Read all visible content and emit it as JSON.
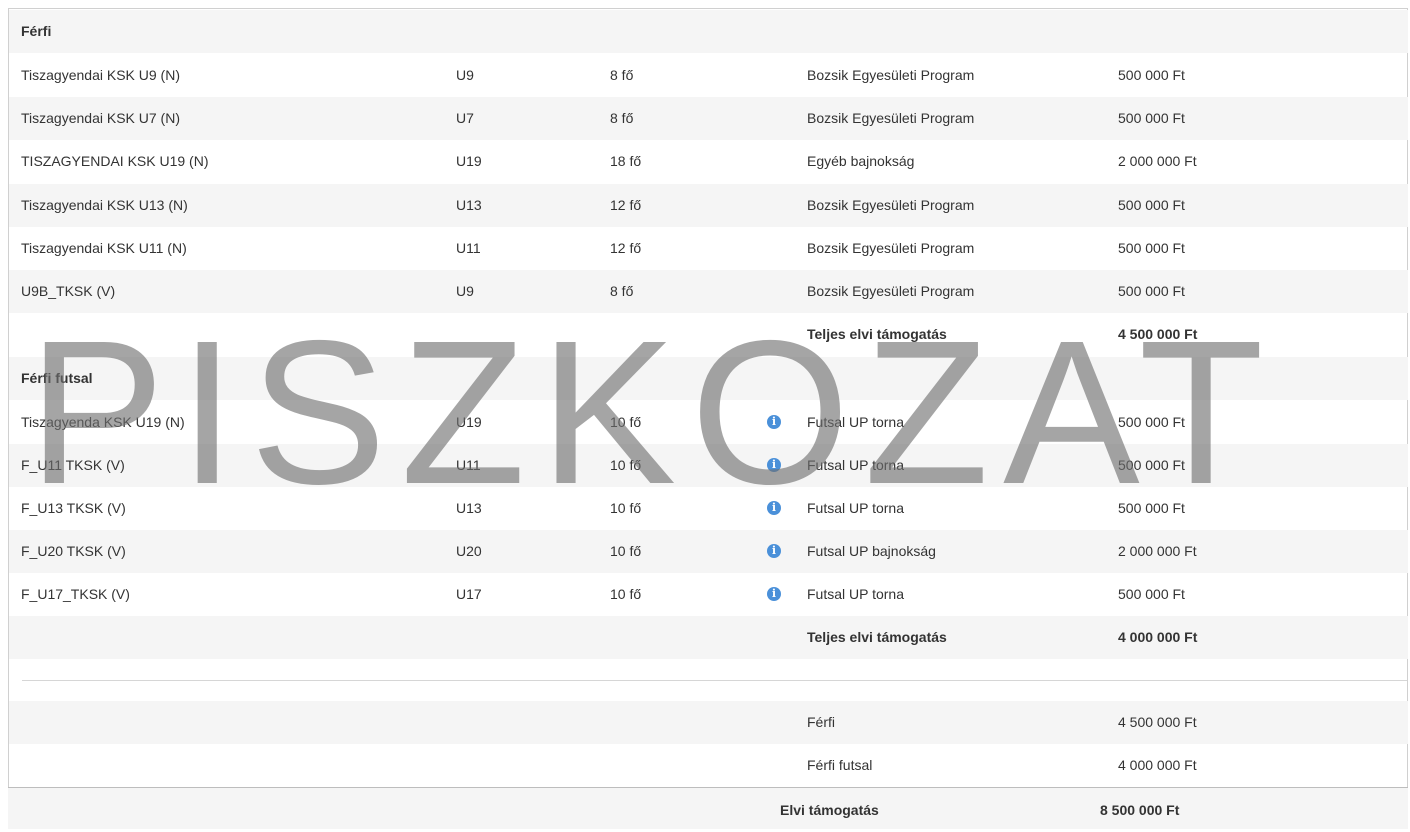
{
  "sections": [
    {
      "title": "Férfi",
      "rows": [
        {
          "name": "Tiszagyendai KSK U9 (N)",
          "age": "U9",
          "count": "8 fő",
          "info": false,
          "comp": "Bozsik Egyesületi Program",
          "amount": "500 000 Ft"
        },
        {
          "name": "Tiszagyendai KSK U7 (N)",
          "age": "U7",
          "count": "8 fő",
          "info": false,
          "comp": "Bozsik Egyesületi Program",
          "amount": "500 000 Ft"
        },
        {
          "name": "TISZAGYENDAI KSK U19 (N)",
          "age": "U19",
          "count": "18 fő",
          "info": false,
          "comp": "Egyéb bajnokság",
          "amount": "2 000 000 Ft"
        },
        {
          "name": "Tiszagyendai KSK U13 (N)",
          "age": "U13",
          "count": "12 fő",
          "info": false,
          "comp": "Bozsik Egyesületi Program",
          "amount": "500 000 Ft"
        },
        {
          "name": "Tiszagyendai KSK U11 (N)",
          "age": "U11",
          "count": "12 fő",
          "info": false,
          "comp": "Bozsik Egyesületi Program",
          "amount": "500 000 Ft"
        },
        {
          "name": "U9B_TKSK (V)",
          "age": "U9",
          "count": "8 fő",
          "info": false,
          "comp": "Bozsik Egyesületi Program",
          "amount": "500 000 Ft"
        }
      ],
      "total_label": "Teljes elvi támogatás",
      "total_amount": "4 500 000 Ft"
    },
    {
      "title": "Férfi futsal",
      "rows": [
        {
          "name": "Tiszagyenda KSK U19 (N)",
          "age": "U19",
          "count": "10 fő",
          "info": true,
          "comp": "Futsal UP torna",
          "amount": "500 000 Ft"
        },
        {
          "name": "F_U11 TKSK (V)",
          "age": "U11",
          "count": "10 fő",
          "info": true,
          "comp": "Futsal UP torna",
          "amount": "500 000 Ft"
        },
        {
          "name": "F_U13 TKSK (V)",
          "age": "U13",
          "count": "10 fő",
          "info": true,
          "comp": "Futsal UP torna",
          "amount": "500 000 Ft"
        },
        {
          "name": "F_U20 TKSK (V)",
          "age": "U20",
          "count": "10 fő",
          "info": true,
          "comp": "Futsal UP bajnokság",
          "amount": "2 000 000 Ft"
        },
        {
          "name": "F_U17_TKSK (V)",
          "age": "U17",
          "count": "10 fő",
          "info": true,
          "comp": "Futsal UP torna",
          "amount": "500 000 Ft"
        }
      ],
      "total_label": "Teljes elvi támogatás",
      "total_amount": "4 000 000 Ft"
    }
  ],
  "summary": [
    {
      "label": "Férfi",
      "amount": "4 500 000 Ft"
    },
    {
      "label": "Férfi futsal",
      "amount": "4 000 000 Ft"
    }
  ],
  "grand_total": {
    "label": "Elvi támogatás",
    "amount": "8 500 000 Ft"
  },
  "watermark": "PISZKOZAT",
  "info_icon": "info-icon",
  "colors": {
    "stripe": "#f5f5f5",
    "info": "#4a90d9",
    "watermark": "#6e6e6e"
  }
}
